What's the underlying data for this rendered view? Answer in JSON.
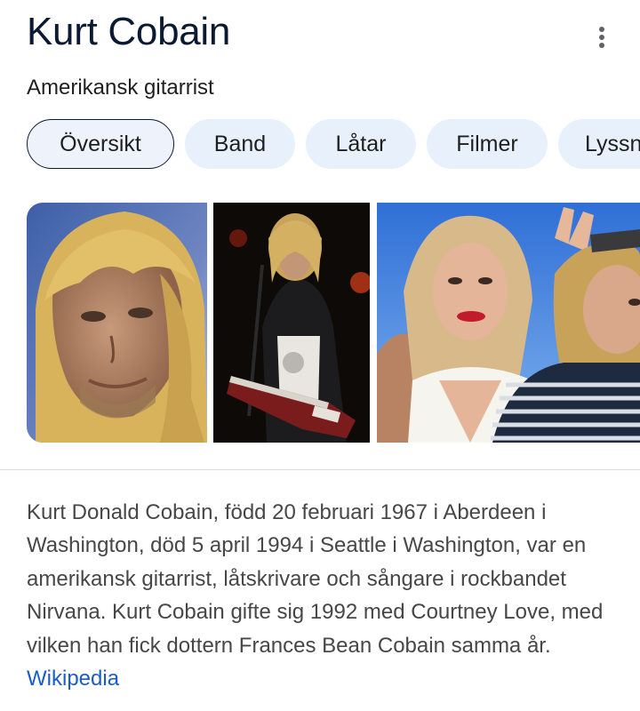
{
  "header": {
    "title": "Kurt Cobain",
    "subtitle": "Amerikansk gitarrist",
    "more_icon": "more-vert-icon"
  },
  "chips": [
    {
      "label": "Översikt",
      "active": true
    },
    {
      "label": "Band",
      "active": false
    },
    {
      "label": "Låtar",
      "active": false
    },
    {
      "label": "Filmer",
      "active": false
    },
    {
      "label": "Lyssna",
      "active": false
    }
  ],
  "images": [
    {
      "name": "portrait"
    },
    {
      "name": "concert"
    },
    {
      "name": "couple"
    }
  ],
  "description": {
    "text": "Kurt Donald Cobain, född 20 februari 1967 i Aberdeen i Washington, död 5 april 1994 i Seattle i Washington, var en amerikansk gitarrist, låtskrivare och sångare i rockbandet Nirvana. Kurt Cobain gifte sig 1992 med Courtney Love, med vilken han fick dottern Frances Bean Cobain samma år.",
    "source_label": "Wikipedia"
  },
  "colors": {
    "title": "#0b1a33",
    "chip_bg": "#e8f0fc",
    "link": "#1a5dc8",
    "body_text": "#474747"
  }
}
